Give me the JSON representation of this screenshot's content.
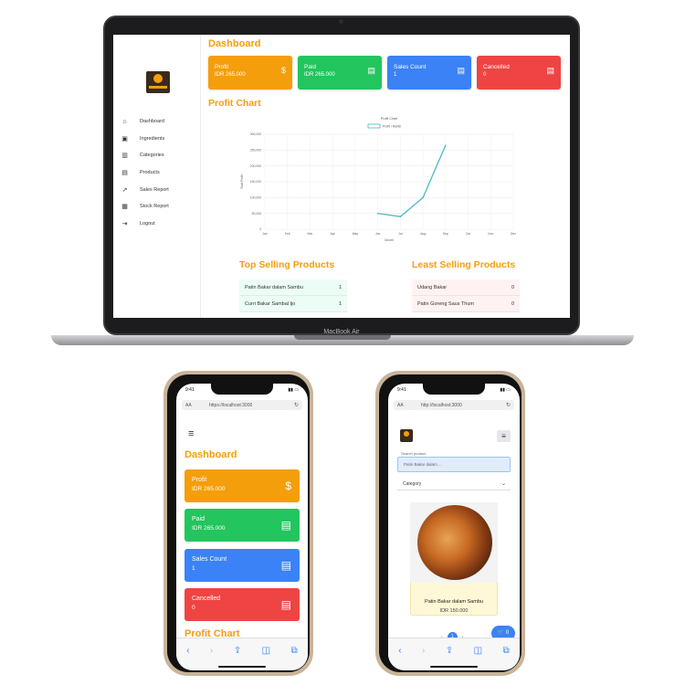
{
  "laptop": {
    "brand": "MacBook Air",
    "sidebar": {
      "items": [
        {
          "label": "Dashboard",
          "icon": "home-icon",
          "glyph": "⌂"
        },
        {
          "label": "Ingredients",
          "icon": "archive-icon",
          "glyph": "▣"
        },
        {
          "label": "Categories",
          "icon": "building-icon",
          "glyph": "▥"
        },
        {
          "label": "Products",
          "icon": "box-icon",
          "glyph": "▤"
        },
        {
          "label": "Sales Report",
          "icon": "trend-icon",
          "glyph": "↗"
        },
        {
          "label": "Stock Report",
          "icon": "warehouse-icon",
          "glyph": "▦"
        },
        {
          "label": "Logout",
          "icon": "logout-icon",
          "glyph": "⇥"
        }
      ]
    },
    "dashboard_title": "Dashboard",
    "cards": [
      {
        "title": "Profit",
        "value": "IDR 265.000",
        "icon": "dollar-icon",
        "glyph": "$",
        "color": "#f59e0b"
      },
      {
        "title": "Paid",
        "value": "IDR 265.000",
        "icon": "receipt-icon",
        "glyph": "▤",
        "color": "#22c55e"
      },
      {
        "title": "Sales Count",
        "value": "1",
        "icon": "receipt-icon",
        "glyph": "▤",
        "color": "#3b82f6"
      },
      {
        "title": "Cancelled",
        "value": "0",
        "icon": "receipt-icon",
        "glyph": "▤",
        "color": "#ef4444"
      }
    ],
    "profit_chart_title": "Profit Chart",
    "top_selling_title": "Top Selling Products",
    "least_selling_title": "Least Selling Products",
    "top_selling": [
      {
        "name": "Patin Bakar dalam Sambu",
        "qty": "1"
      },
      {
        "name": "Curri Bakar Sambal Ijo",
        "qty": "1"
      }
    ],
    "least_selling": [
      {
        "name": "Udang Bakar",
        "qty": "0"
      },
      {
        "name": "Patin Goreng Saus Thum",
        "qty": "0"
      }
    ]
  },
  "chart_data": {
    "type": "line",
    "title": "Profit Chart",
    "legend": "Profit / Month",
    "xlabel": "Month",
    "ylabel": "Total Profit",
    "categories": [
      "Jan",
      "Feb",
      "Mar",
      "Apr",
      "May",
      "Jun",
      "Jul",
      "Aug",
      "Sep",
      "Oct",
      "Nov",
      "Dec"
    ],
    "series": [
      {
        "name": "Profit / Month",
        "values": [
          null,
          null,
          null,
          null,
          null,
          50000,
          40000,
          100000,
          265000,
          null,
          null,
          null
        ]
      }
    ],
    "ylim": [
      0,
      300000
    ],
    "yticks": [
      "0",
      "50,000",
      "100,000",
      "150,000",
      "200,000",
      "250,000",
      "300,000"
    ],
    "line_color": "#4bb8c8",
    "grid": true,
    "legend_position": "top"
  },
  "phone1": {
    "time": "9:41",
    "url": "https://localhost:3000",
    "aa": "AA",
    "menu_icon": "≡",
    "dashboard_title": "Dashboard",
    "cards": [
      {
        "title": "Profit",
        "value": "IDR 265.000",
        "glyph": "$"
      },
      {
        "title": "Paid",
        "value": "IDR 265.000",
        "glyph": "▤"
      },
      {
        "title": "Sales Count",
        "value": "1",
        "glyph": "▤"
      },
      {
        "title": "Cancelled",
        "value": "0",
        "glyph": "▤"
      }
    ],
    "profit_chart_title": "Profit Chart"
  },
  "phone2": {
    "time": "9:41",
    "url": "http://localhost:3000",
    "aa": "AA",
    "menu_icon": "≡",
    "search_label": "Search product",
    "search_placeholder": "Patin Bakar dalam ...",
    "category_label": "Category",
    "product_name": "Patin Bakar dalam Sambu",
    "product_price": "IDR 150.000",
    "page_prev": "‹",
    "page_current": "1",
    "page_next": "›",
    "cart_count": "0"
  },
  "browser_toolbar": {
    "back": "‹",
    "forward": "›",
    "share": "⇪",
    "bookmarks": "◫",
    "tabs": "⧉"
  }
}
